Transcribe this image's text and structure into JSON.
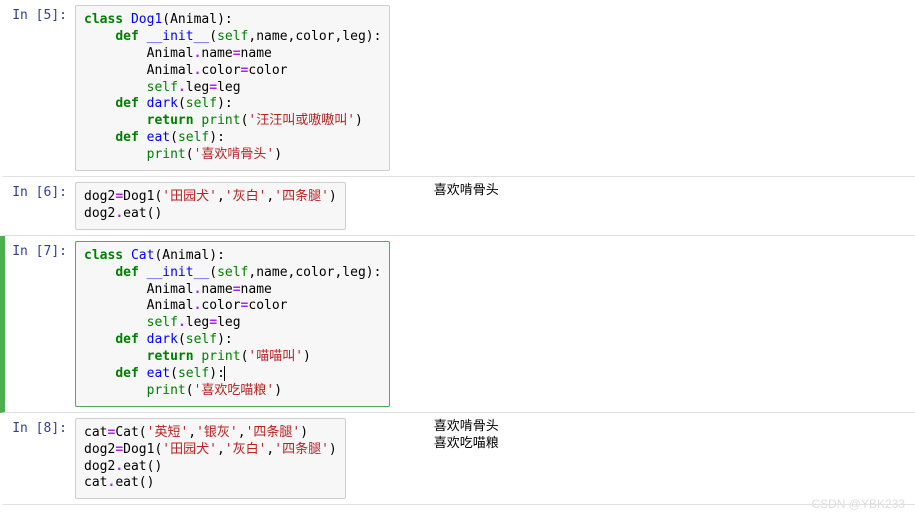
{
  "cells": [
    {
      "prompt": "In  [5]:",
      "tokens": [
        {
          "t": "class ",
          "c": "kw"
        },
        {
          "t": "Dog1",
          "c": "nm"
        },
        {
          "t": "(Animal):",
          "c": "pn"
        },
        {
          "t": "\n    ",
          "c": "pn"
        },
        {
          "t": "def ",
          "c": "kw"
        },
        {
          "t": "__init__",
          "c": "fn"
        },
        {
          "t": "(",
          "c": "pn"
        },
        {
          "t": "self",
          "c": "bi"
        },
        {
          "t": ",name,color,leg):",
          "c": "pn"
        },
        {
          "t": "\n        Animal",
          "c": "pn"
        },
        {
          "t": ".",
          "c": "op"
        },
        {
          "t": "name",
          "c": "pn"
        },
        {
          "t": "=",
          "c": "op"
        },
        {
          "t": "name\n        Animal",
          "c": "pn"
        },
        {
          "t": ".",
          "c": "op"
        },
        {
          "t": "color",
          "c": "pn"
        },
        {
          "t": "=",
          "c": "op"
        },
        {
          "t": "color\n        ",
          "c": "pn"
        },
        {
          "t": "self",
          "c": "bi"
        },
        {
          "t": ".",
          "c": "op"
        },
        {
          "t": "leg",
          "c": "pn"
        },
        {
          "t": "=",
          "c": "op"
        },
        {
          "t": "leg\n    ",
          "c": "pn"
        },
        {
          "t": "def ",
          "c": "kw"
        },
        {
          "t": "dark",
          "c": "nm"
        },
        {
          "t": "(",
          "c": "pn"
        },
        {
          "t": "self",
          "c": "bi"
        },
        {
          "t": "):\n        ",
          "c": "pn"
        },
        {
          "t": "return ",
          "c": "kw"
        },
        {
          "t": "print",
          "c": "bi"
        },
        {
          "t": "(",
          "c": "pn"
        },
        {
          "t": "'汪汪叫或嗷嗷叫'",
          "c": "st"
        },
        {
          "t": ")\n    ",
          "c": "pn"
        },
        {
          "t": "def ",
          "c": "kw"
        },
        {
          "t": "eat",
          "c": "nm"
        },
        {
          "t": "(",
          "c": "pn"
        },
        {
          "t": "self",
          "c": "bi"
        },
        {
          "t": "):\n        ",
          "c": "pn"
        },
        {
          "t": "print",
          "c": "bi"
        },
        {
          "t": "(",
          "c": "pn"
        },
        {
          "t": "'喜欢啃骨头'",
          "c": "st"
        },
        {
          "t": ")",
          "c": "pn"
        }
      ],
      "output": null
    },
    {
      "prompt": "In  [6]:",
      "tokens": [
        {
          "t": "dog2",
          "c": "pn"
        },
        {
          "t": "=",
          "c": "op"
        },
        {
          "t": "Dog1(",
          "c": "pn"
        },
        {
          "t": "'田园犬'",
          "c": "st"
        },
        {
          "t": ",",
          "c": "pn"
        },
        {
          "t": "'灰白'",
          "c": "st"
        },
        {
          "t": ",",
          "c": "pn"
        },
        {
          "t": "'四条腿'",
          "c": "st"
        },
        {
          "t": ")\ndog2",
          "c": "pn"
        },
        {
          "t": ".",
          "c": "op"
        },
        {
          "t": "eat()",
          "c": "pn"
        }
      ],
      "output": "喜欢啃骨头"
    },
    {
      "prompt": "In  [7]:",
      "active": true,
      "tokens": [
        {
          "t": "class ",
          "c": "kw"
        },
        {
          "t": "Cat",
          "c": "nm"
        },
        {
          "t": "(Animal):",
          "c": "pn"
        },
        {
          "t": "\n    ",
          "c": "pn"
        },
        {
          "t": "def ",
          "c": "kw"
        },
        {
          "t": "__init__",
          "c": "fn"
        },
        {
          "t": "(",
          "c": "pn"
        },
        {
          "t": "self",
          "c": "bi"
        },
        {
          "t": ",name,color,leg):",
          "c": "pn"
        },
        {
          "t": "\n        Animal",
          "c": "pn"
        },
        {
          "t": ".",
          "c": "op"
        },
        {
          "t": "name",
          "c": "pn"
        },
        {
          "t": "=",
          "c": "op"
        },
        {
          "t": "name\n        Animal",
          "c": "pn"
        },
        {
          "t": ".",
          "c": "op"
        },
        {
          "t": "color",
          "c": "pn"
        },
        {
          "t": "=",
          "c": "op"
        },
        {
          "t": "color\n        ",
          "c": "pn"
        },
        {
          "t": "self",
          "c": "bi"
        },
        {
          "t": ".",
          "c": "op"
        },
        {
          "t": "leg",
          "c": "pn"
        },
        {
          "t": "=",
          "c": "op"
        },
        {
          "t": "leg\n    ",
          "c": "pn"
        },
        {
          "t": "def ",
          "c": "kw"
        },
        {
          "t": "dark",
          "c": "nm"
        },
        {
          "t": "(",
          "c": "pn"
        },
        {
          "t": "self",
          "c": "bi"
        },
        {
          "t": "):\n        ",
          "c": "pn"
        },
        {
          "t": "return ",
          "c": "kw"
        },
        {
          "t": "print",
          "c": "bi"
        },
        {
          "t": "(",
          "c": "pn"
        },
        {
          "t": "'喵喵叫'",
          "c": "st"
        },
        {
          "t": ")\n    ",
          "c": "pn"
        },
        {
          "t": "def ",
          "c": "kw"
        },
        {
          "t": "eat",
          "c": "nm"
        },
        {
          "t": "(",
          "c": "pn"
        },
        {
          "t": "self",
          "c": "bi"
        },
        {
          "t": "):",
          "c": "pn"
        },
        {
          "t": "",
          "c": "cursor"
        },
        {
          "t": "\n        ",
          "c": "pn"
        },
        {
          "t": "print",
          "c": "bi"
        },
        {
          "t": "(",
          "c": "pn"
        },
        {
          "t": "'喜欢吃喵粮'",
          "c": "st"
        },
        {
          "t": ")",
          "c": "pn"
        }
      ],
      "output": null
    },
    {
      "prompt": "In  [8]:",
      "tokens": [
        {
          "t": "cat",
          "c": "pn"
        },
        {
          "t": "=",
          "c": "op"
        },
        {
          "t": "Cat(",
          "c": "pn"
        },
        {
          "t": "'英短'",
          "c": "st"
        },
        {
          "t": ",",
          "c": "pn"
        },
        {
          "t": "'银灰'",
          "c": "st"
        },
        {
          "t": ",",
          "c": "pn"
        },
        {
          "t": "'四条腿'",
          "c": "st"
        },
        {
          "t": ")\ndog2",
          "c": "pn"
        },
        {
          "t": "=",
          "c": "op"
        },
        {
          "t": "Dog1(",
          "c": "pn"
        },
        {
          "t": "'田园犬'",
          "c": "st"
        },
        {
          "t": ",",
          "c": "pn"
        },
        {
          "t": "'灰白'",
          "c": "st"
        },
        {
          "t": ",",
          "c": "pn"
        },
        {
          "t": "'四条腿'",
          "c": "st"
        },
        {
          "t": ")\ndog2",
          "c": "pn"
        },
        {
          "t": ".",
          "c": "op"
        },
        {
          "t": "eat()\ncat",
          "c": "pn"
        },
        {
          "t": ".",
          "c": "op"
        },
        {
          "t": "eat()",
          "c": "pn"
        }
      ],
      "output": "喜欢啃骨头\n喜欢吃喵粮"
    }
  ],
  "watermark": "CSDN @YBK233"
}
